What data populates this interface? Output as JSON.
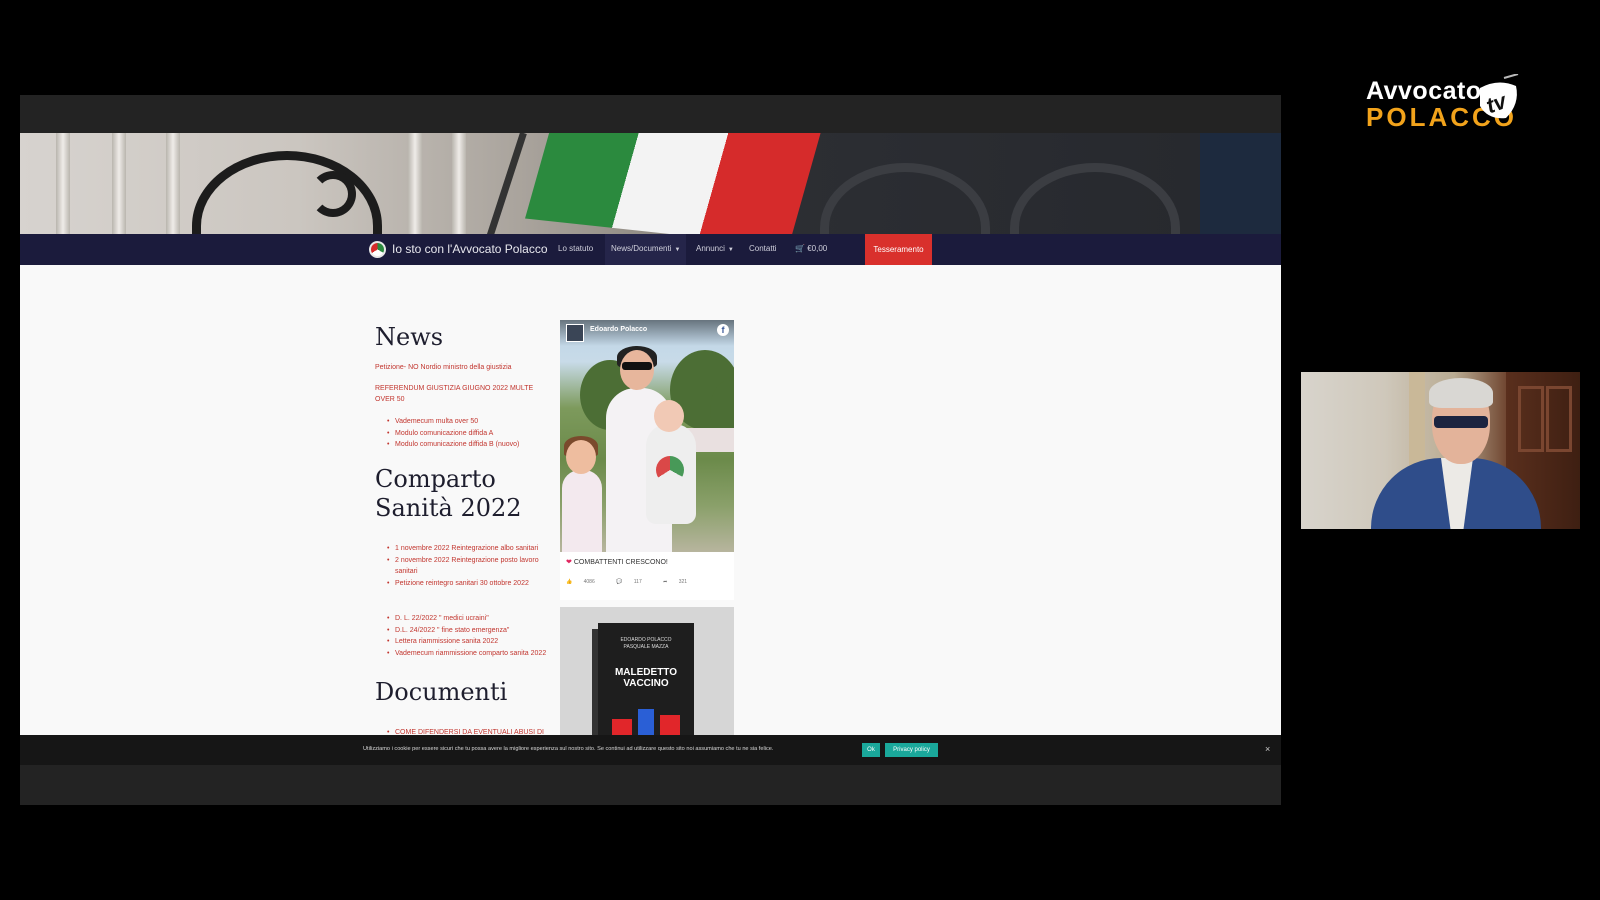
{
  "brand": {
    "line1": "Avvocato",
    "line2": "POLACCO",
    "tv": "tv"
  },
  "site": {
    "name": "Io sto con l'Avvocato Polacco",
    "nav": [
      {
        "label": "Lo statuto"
      },
      {
        "label": "News/Documenti"
      },
      {
        "label": "Annunci"
      },
      {
        "label": "Contatti"
      },
      {
        "label": "€0,00"
      }
    ],
    "cta": "Tesseramento"
  },
  "news": {
    "title": "News",
    "link1": "Petizione- NO Nordio ministro della giustizia",
    "link2": "REFERENDUM GIUSTIZIA GIUGNO 2022 MULTE OVER 50",
    "items": [
      "Vademecum multa over 50",
      "Modulo comunicazione diffida A",
      "Modulo comunicazione diffida B (nuovo)"
    ]
  },
  "sanita": {
    "title_line1": "Comparto",
    "title_line2": "Sanità 2022",
    "items_a": [
      "1 novembre 2022 Reintegrazione albo sanitari",
      "2 novembre 2022 Reintegrazione posto lavoro sanitari",
      "Petizione reintegro sanitari 30 ottobre 2022"
    ],
    "items_b": [
      "D. L. 22/2022 \" medici ucraini\"",
      "D.L. 24/2022 \" fine stato emergenza\"",
      "Lettera riammissione sanita 2022",
      "Vademecum riammissione comparto sanita 2022"
    ]
  },
  "documenti": {
    "title": "Documenti",
    "item": "COME DIFENDERSI DA EVENTUALI ABUSI DI"
  },
  "facebook": {
    "author": "Edoardo Polacco",
    "icon": "f",
    "banner": "mamy",
    "caption": "COMBATTENTI CRESCONO!",
    "likes": "4086",
    "comments": "117",
    "shares": "321"
  },
  "book": {
    "authors": "EDOARDO POLACCO\nPASQUALE MAZZA",
    "title": "MALEDETTO VACCINO"
  },
  "cookie": {
    "text": "Utilizziamo i cookie per essere sicuri che tu possa avere la migliore esperienza sul nostro sito. Se continui ad utilizzare questo sito noi assumiamo che tu ne sia felice.",
    "ok": "Ok",
    "privacy": "Privacy policy",
    "close": "×"
  },
  "colors": {
    "nav_bg": "#1b1b3c",
    "cta": "#d9302c",
    "link": "#c2362f",
    "cookie_btn": "#1aa89b",
    "brand_orange": "#f2a31b"
  }
}
